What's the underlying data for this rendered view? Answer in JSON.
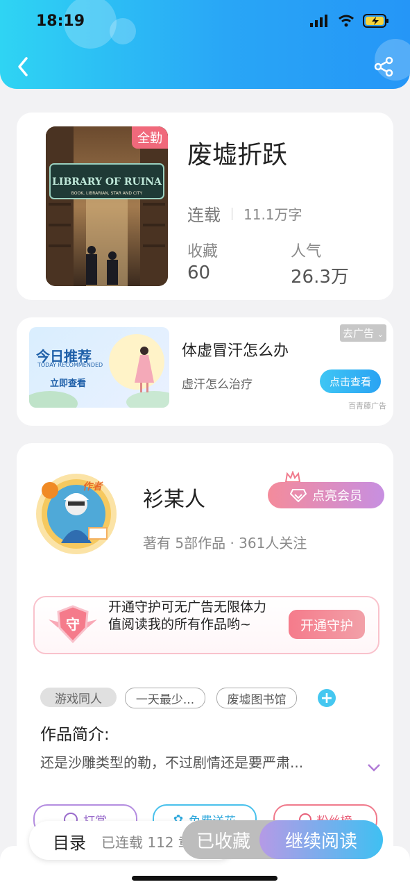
{
  "status_bar": {
    "time": "18:19"
  },
  "book": {
    "cover_badge": "全勤",
    "cover_art_title": "LIBRARY OF RUINA",
    "cover_art_subtitle": "BOOK, LIBRARIAN, STAR AND CITY",
    "title": "废墟折跃",
    "status": "连载",
    "word_count": "11.1万字",
    "favorites_label": "收藏",
    "favorites_value": "60",
    "popularity_label": "人气",
    "popularity_value": "26.3万"
  },
  "ad": {
    "banner_title": "今日推荐",
    "banner_sub": "TODAY RECOMMENDED",
    "banner_cta": "立即查看",
    "title": "体虚冒汗怎么办",
    "subtitle": "虚汗怎么治疗",
    "button": "点击查看",
    "remove": "去广告",
    "source": "百青藤广告"
  },
  "author": {
    "badge": "作者",
    "name": "衫某人",
    "works_prefix": "著有",
    "works_count": "5",
    "works_suffix": "部作品 ·",
    "followers_count": "361",
    "followers_suffix": "人关注",
    "vip_button": "点亮会员"
  },
  "guard": {
    "icon_label": "守",
    "text": "开通守护可无广告无限体力值阅读我的所有作品哟~",
    "button": "开通守护"
  },
  "tags": [
    "游戏同人",
    "一天最少...",
    "废墟图书馆"
  ],
  "intro": {
    "title": "作品简介:",
    "text": "还是沙雕类型的勒，不过剧情还是要严肃..."
  },
  "actions": [
    "打赏",
    "免费送花",
    "粉丝榜"
  ],
  "bottom": {
    "toc_label": "目录",
    "toc_count": "已连载 112 章",
    "favorited_button": "已收藏",
    "continue_button": "继续阅读"
  },
  "colors": {
    "header_start": "#2fd4f3",
    "header_end": "#2596f7",
    "badge": "#f0697b",
    "accent_blue": "#45c7f0",
    "vip_pink": "#f48b9b",
    "vip_purple": "#c78fe1"
  }
}
